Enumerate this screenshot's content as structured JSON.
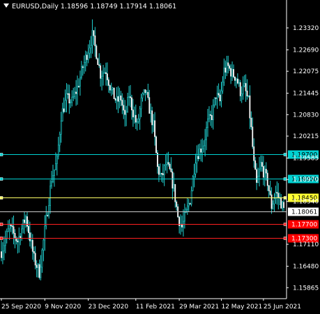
{
  "chart_data": {
    "type": "candlestick",
    "symbol": "EURUSD,Daily",
    "ohlc_header": [
      "1.18596",
      "1.18749",
      "1.17914",
      "1.18061"
    ],
    "y_ticks": [
      "1.23320",
      "1.22690",
      "1.22075",
      "1.21445",
      "1.20830",
      "1.20215",
      "1.19585",
      "1.18970",
      "1.18340",
      "1.17110",
      "1.16480",
      "1.15865"
    ],
    "ylim": [
      1.1555,
      1.2376
    ],
    "x_ticks": [
      {
        "label": "25 Sep 2020",
        "bar": 0
      },
      {
        "label": "9 Nov 2020",
        "bar": 32
      },
      {
        "label": "23 Dec 2020",
        "bar": 64
      },
      {
        "label": "11 Feb 2021",
        "bar": 99
      },
      {
        "label": "29 Mar 2021",
        "bar": 131
      },
      {
        "label": "12 May 2021",
        "bar": 162
      },
      {
        "label": "25 Jun 2021",
        "bar": 193
      }
    ],
    "levels": [
      {
        "value": 1.197,
        "label": "1.19700",
        "color": "#00d2d2",
        "label_bg": "#00d2d2",
        "label_fg": "#000000"
      },
      {
        "value": 1.19,
        "label": "1.19000",
        "color": "#00d2d2",
        "label_bg": "#00d2d2",
        "label_fg": "#000000"
      },
      {
        "value": 1.1845,
        "label": "1.18450",
        "color": "#ffff66",
        "label_bg": "#ffff33",
        "label_fg": "#000000"
      },
      {
        "value": 1.18061,
        "label": "1.18061",
        "color": "#cccccc",
        "label_bg": "#ffffff",
        "label_fg": "#000000"
      },
      {
        "value": 1.177,
        "label": "1.17700",
        "color": "#ff2020",
        "label_bg": "#ff0000",
        "label_fg": "#ffffff"
      },
      {
        "value": 1.173,
        "label": "1.17300",
        "color": "#ff2020",
        "label_bg": "#ff0000",
        "label_fg": "#ffffff"
      }
    ],
    "candle_color": "#20d0d0",
    "close_path": [
      [
        0,
        1.169
      ],
      [
        6,
        1.176
      ],
      [
        12,
        1.172
      ],
      [
        18,
        1.179
      ],
      [
        24,
        1.167
      ],
      [
        28,
        1.163
      ],
      [
        33,
        1.178
      ],
      [
        37,
        1.19
      ],
      [
        41,
        1.195
      ],
      [
        44,
        1.208
      ],
      [
        48,
        1.213
      ],
      [
        52,
        1.212
      ],
      [
        56,
        1.216
      ],
      [
        60,
        1.222
      ],
      [
        64,
        1.227
      ],
      [
        67,
        1.231
      ],
      [
        70,
        1.226
      ],
      [
        73,
        1.22
      ],
      [
        77,
        1.221
      ],
      [
        81,
        1.215
      ],
      [
        85,
        1.212
      ],
      [
        88,
        1.213
      ],
      [
        91,
        1.207
      ],
      [
        94,
        1.214
      ],
      [
        97,
        1.209
      ],
      [
        100,
        1.205
      ],
      [
        103,
        1.212
      ],
      [
        106,
        1.215
      ],
      [
        109,
        1.21
      ],
      [
        112,
        1.205
      ],
      [
        115,
        1.193
      ],
      [
        118,
        1.19
      ],
      [
        121,
        1.194
      ],
      [
        124,
        1.192
      ],
      [
        127,
        1.187
      ],
      [
        130,
        1.179
      ],
      [
        133,
        1.176
      ],
      [
        136,
        1.18
      ],
      [
        139,
        1.184
      ],
      [
        143,
        1.196
      ],
      [
        146,
        1.198
      ],
      [
        149,
        1.2
      ],
      [
        152,
        1.206
      ],
      [
        155,
        1.208
      ],
      [
        158,
        1.214
      ],
      [
        161,
        1.212
      ],
      [
        164,
        1.221
      ],
      [
        167,
        1.222
      ],
      [
        170,
        1.22
      ],
      [
        173,
        1.219
      ],
      [
        176,
        1.215
      ],
      [
        179,
        1.216
      ],
      [
        182,
        1.212
      ],
      [
        184,
        1.204
      ],
      [
        186,
        1.194
      ],
      [
        188,
        1.188
      ],
      [
        191,
        1.194
      ],
      [
        194,
        1.191
      ],
      [
        196,
        1.189
      ],
      [
        199,
        1.182
      ],
      [
        202,
        1.186
      ],
      [
        205,
        1.184
      ],
      [
        208,
        1.181
      ]
    ]
  }
}
